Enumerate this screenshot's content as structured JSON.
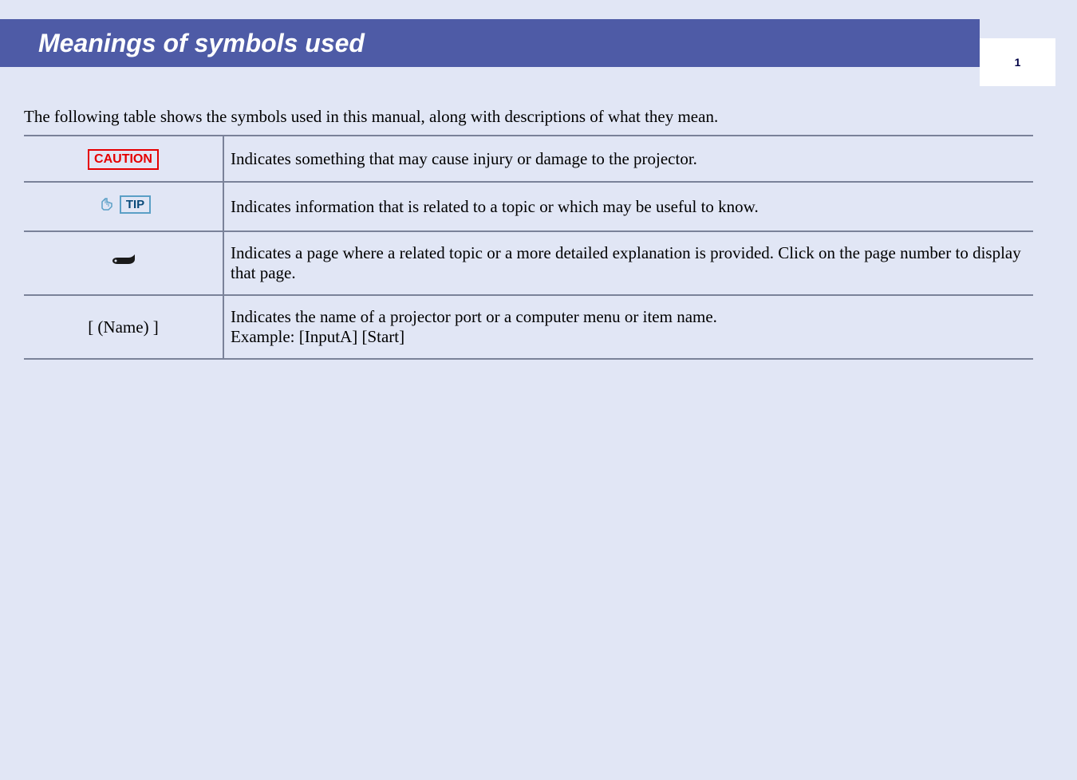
{
  "header": {
    "title": "Meanings of symbols used",
    "page_number": "1"
  },
  "intro": "The following table shows the symbols used in this manual, along with descriptions of what they mean.",
  "table": {
    "rows": [
      {
        "symbol_label": "CAUTION",
        "description": "Indicates something that may cause injury or damage to the projector."
      },
      {
        "symbol_label": "TIP",
        "description": "Indicates information that is related to a topic or which may be useful to know."
      },
      {
        "symbol_label": "",
        "description": "Indicates a page where a related topic or a more detailed explanation is provided. Click on the page number to display that page."
      },
      {
        "symbol_label": "[ (Name) ]",
        "description": "Indicates the name of a projector port or a computer menu or item name.\nExample: [InputA]  [Start]"
      }
    ]
  }
}
